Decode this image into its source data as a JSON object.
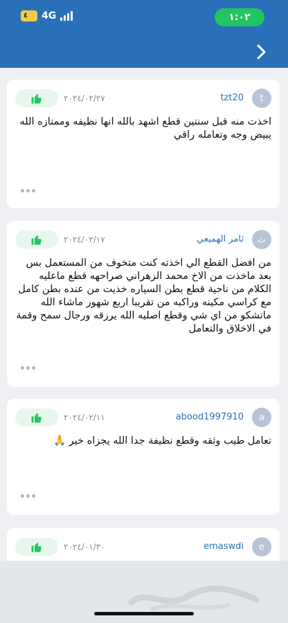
{
  "status_bar": {
    "time": "١:٠٢",
    "network": "4G",
    "sim_badge": "٤"
  },
  "reviews": [
    {
      "avatar": "t",
      "username": "tzt20",
      "date": "٢٠٢٤/٠٢/٢٧",
      "text": "اخذت منه قبل سنتين قطع اشهد بالله انها نظيفه وممتازه الله يبيض وجه وتعامله راقي"
    },
    {
      "avatar": "ث",
      "username": "ثامر الهميعي",
      "date": "٢٠٢٤/٠٢/١٧",
      "text": "من افضل القطع الي اخذته كنت متخوف من المستعمل بس بعد ماخذت من الاخ محمد الزهراني صراحهه قطع ماعليه الكلام من ناحية قطع بطن السياره خذيت من عنده بطن كامل مع كراسي مكينه وراكبه من تقريبا اربع شهور ماشاء الله ماتشكو من اي شي وقطع اصليه الله يرزقه ورجال سمح وقمة في الاخلاق والتعامل"
    },
    {
      "avatar": "a",
      "username": "abood1997910",
      "date": "٢٠٢٤/٠٢/١١",
      "text": "تعامل طيب وثقه وقطع نظيفة جدا الله يجزاه خير 🙏"
    },
    {
      "avatar": "e",
      "username": "emaswdi",
      "date": "٢٠٢٤/٠١/٣٠",
      "text": ""
    }
  ],
  "colors": {
    "brand": "#2a70b8",
    "like_green": "#22c55e",
    "status_green": "#22c55e"
  },
  "icons": {
    "back": "chevron-right-icon",
    "like": "thumbs-up-icon",
    "more": "more-dots-icon"
  },
  "watermark": "haraj-logo"
}
